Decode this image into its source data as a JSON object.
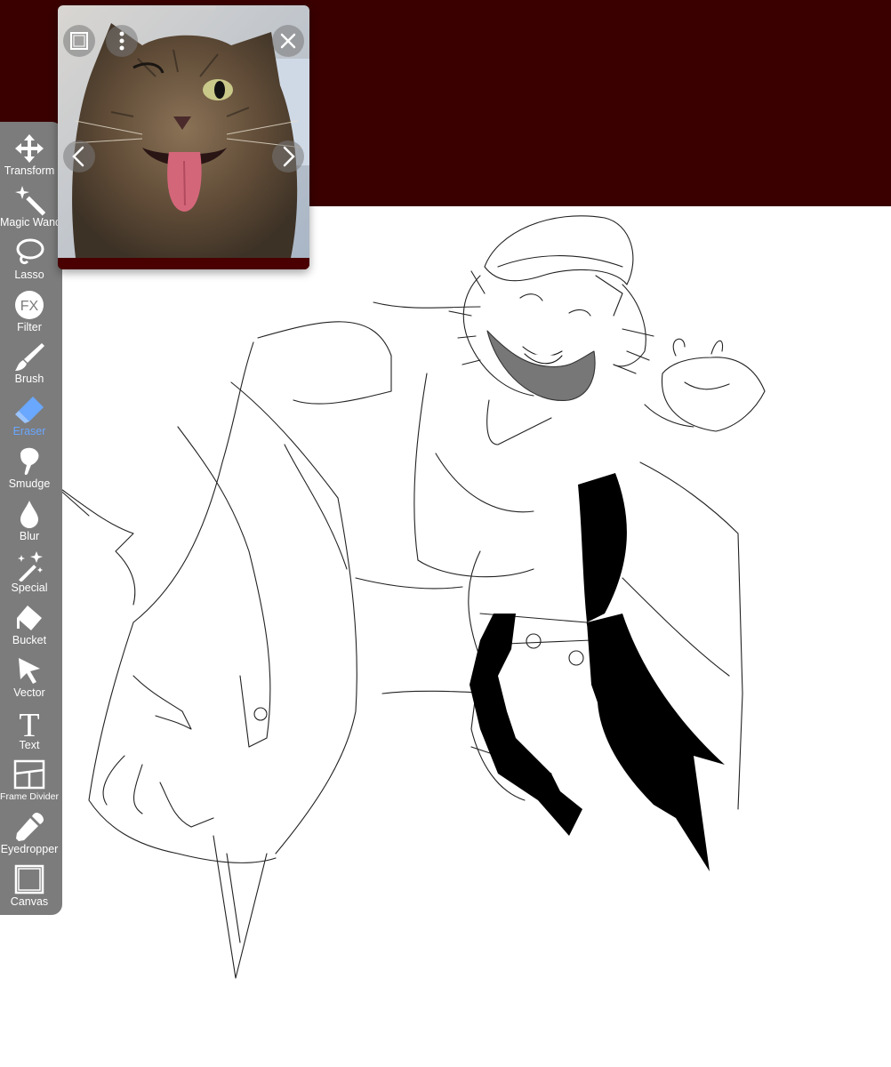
{
  "toolbar": {
    "active_tool": "Eraser",
    "accent_color": "#6aa7ff",
    "tools": [
      {
        "name": "Transform",
        "icon": "move-arrows-icon"
      },
      {
        "name": "Magic Wand",
        "icon": "magic-wand-icon"
      },
      {
        "name": "Lasso",
        "icon": "lasso-icon"
      },
      {
        "name": "Filter",
        "icon": "fx-filter-icon",
        "glyph": "FX"
      },
      {
        "name": "Brush",
        "icon": "brush-icon"
      },
      {
        "name": "Eraser",
        "icon": "eraser-icon"
      },
      {
        "name": "Smudge",
        "icon": "smudge-icon"
      },
      {
        "name": "Blur",
        "icon": "blur-drop-icon"
      },
      {
        "name": "Special",
        "icon": "sparkle-wand-icon"
      },
      {
        "name": "Bucket",
        "icon": "bucket-icon"
      },
      {
        "name": "Vector",
        "icon": "vector-cursor-icon"
      },
      {
        "name": "Text",
        "icon": "text-t-icon",
        "glyph": "T"
      },
      {
        "name": "Frame Divider",
        "icon": "frame-divider-icon"
      },
      {
        "name": "Eyedropper",
        "icon": "eyedropper-icon"
      },
      {
        "name": "Canvas",
        "icon": "canvas-square-icon"
      }
    ]
  },
  "reference_window": {
    "buttons": [
      "layout-icon",
      "more-vertical-icon",
      "close-icon",
      "previous-chevron-icon",
      "next-chevron-icon"
    ]
  },
  "colors": {
    "background": "#3a0000",
    "canvas": "#ffffff",
    "toolbar": "#7c7c7c"
  }
}
